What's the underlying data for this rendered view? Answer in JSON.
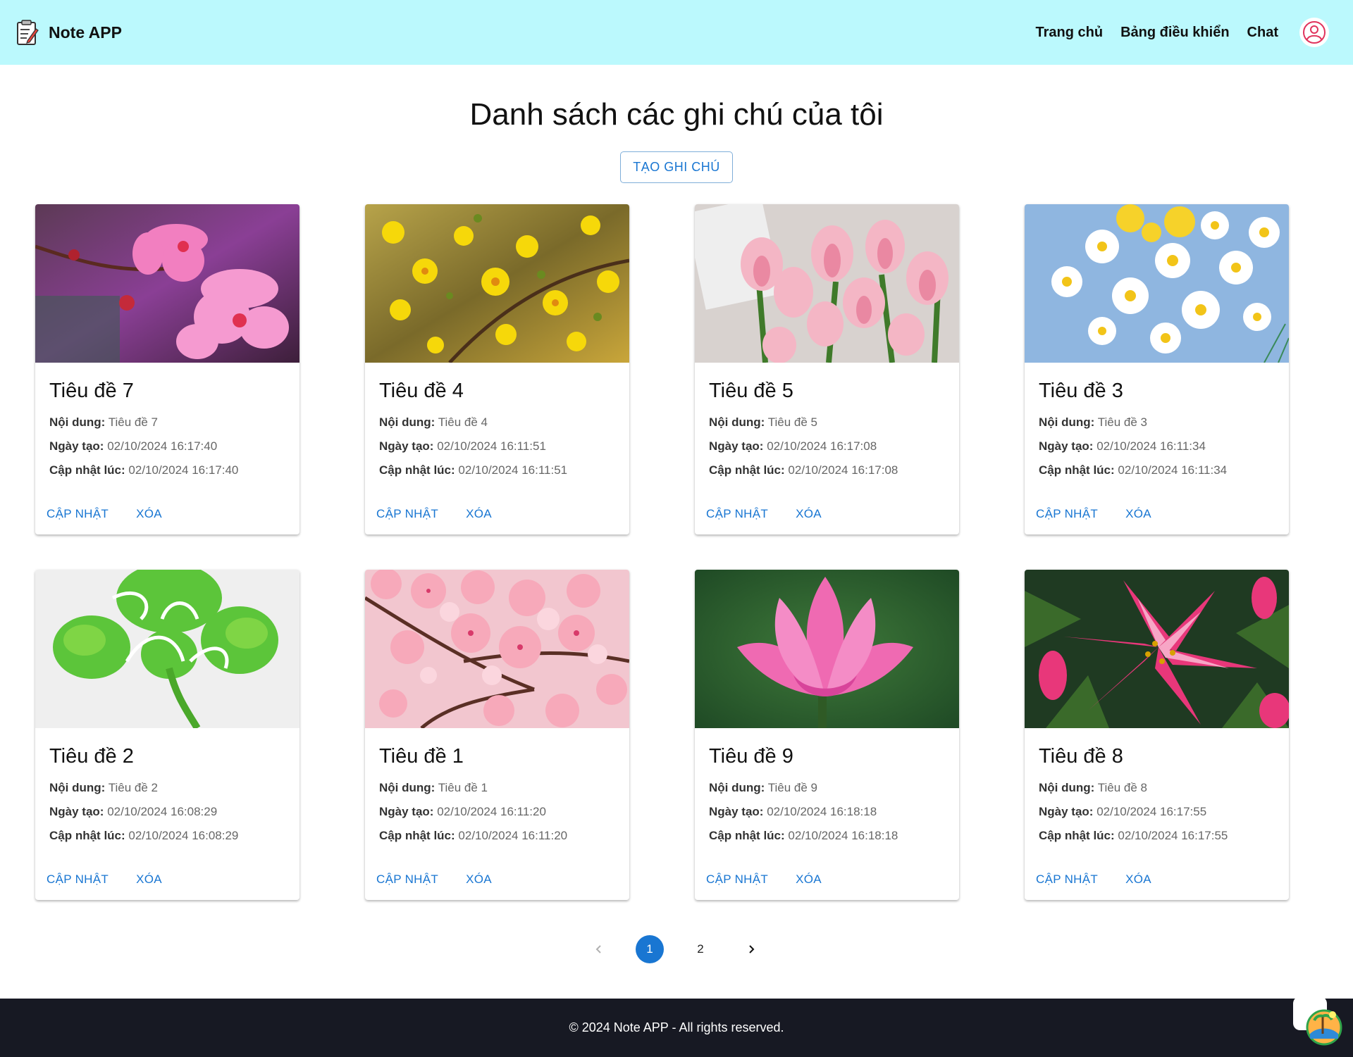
{
  "app": {
    "name": "Note APP",
    "logo_icon": "clipboard-note-icon"
  },
  "nav": {
    "links": [
      "Trang chủ",
      "Bảng điều khiển",
      "Chat"
    ],
    "avatar_icon": "user-circle-icon",
    "accent": "#bbf9fd"
  },
  "main": {
    "title": "Danh sách các ghi chú của tôi",
    "create_button": "TẠO GHI CHÚ"
  },
  "labels": {
    "content": "Nội dung:",
    "created": "Ngày tạo:",
    "updated": "Cập nhật lúc:",
    "update_button": "CẬP NHẬT",
    "delete_button": "XÓA"
  },
  "notes": [
    {
      "title": "Tiêu đề 7",
      "content": "Tiêu đề 7",
      "created": "02/10/2024 16:17:40",
      "updated": "02/10/2024 16:17:40",
      "image": "pink-orchid"
    },
    {
      "title": "Tiêu đề 4",
      "content": "Tiêu đề 4",
      "created": "02/10/2024 16:11:51",
      "updated": "02/10/2024 16:11:51",
      "image": "yellow-apricot-blossom"
    },
    {
      "title": "Tiêu đề 5",
      "content": "Tiêu đề 5",
      "created": "02/10/2024 16:17:08",
      "updated": "02/10/2024 16:17:08",
      "image": "pink-tulips"
    },
    {
      "title": "Tiêu đề 3",
      "content": "Tiêu đề 3",
      "created": "02/10/2024 16:11:34",
      "updated": "02/10/2024 16:11:34",
      "image": "white-daisies"
    },
    {
      "title": "Tiêu đề 2",
      "content": "Tiêu đề 2",
      "created": "02/10/2024 16:08:29",
      "updated": "02/10/2024 16:08:29",
      "image": "good-luck-clover"
    },
    {
      "title": "Tiêu đề 1",
      "content": "Tiêu đề 1",
      "created": "02/10/2024 16:11:20",
      "updated": "02/10/2024 16:11:20",
      "image": "cherry-blossom"
    },
    {
      "title": "Tiêu đề 9",
      "content": "Tiêu đề 9",
      "created": "02/10/2024 16:18:18",
      "updated": "02/10/2024 16:18:18",
      "image": "pink-lotus"
    },
    {
      "title": "Tiêu đề 8",
      "content": "Tiêu đề 8",
      "created": "02/10/2024 16:17:55",
      "updated": "02/10/2024 16:17:55",
      "image": "stargazer-lily"
    }
  ],
  "pagination": {
    "pages": [
      "1",
      "2"
    ],
    "current": "1",
    "prev_icon": "chevron-left-icon",
    "next_icon": "chevron-right-icon"
  },
  "footer": {
    "text": "© 2024 Note APP - All rights reserved.",
    "chat_icon": "chat-bubble-icon"
  },
  "colors": {
    "primary": "#1976d2",
    "footer_bg": "#171923"
  }
}
